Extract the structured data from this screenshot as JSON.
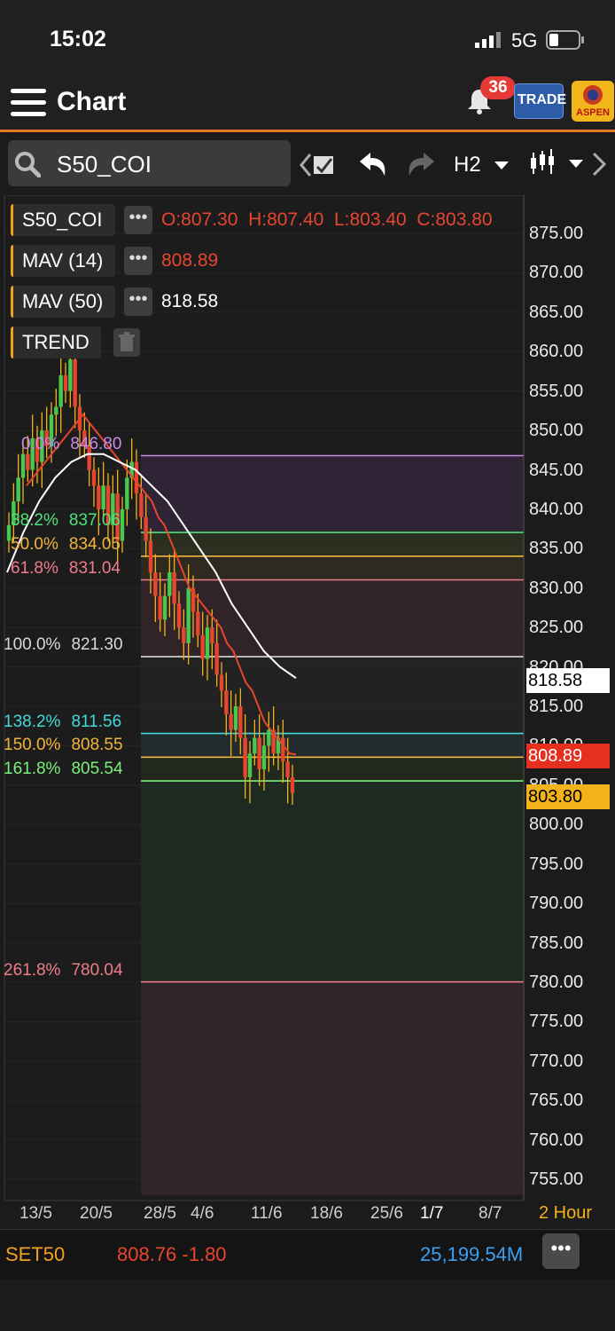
{
  "status": {
    "time": "15:02",
    "network": "5G"
  },
  "header": {
    "title": "Chart",
    "notification_count": "36",
    "trade_label": "TRADE",
    "aspen_label": "ASPEN"
  },
  "toolbar": {
    "symbol": "S50_COI",
    "timeframe": "H2"
  },
  "legend": {
    "symbol": "S50_COI",
    "ohlc": "O:807.30  H:807.40  L:803.40  C:803.80",
    "mav14_label": "MAV (14)",
    "mav14_value": "808.89",
    "mav50_label": "MAV (50)",
    "mav50_value": "818.58",
    "trend_label": "TREND",
    "dots": "•••"
  },
  "price_axis": [
    "875.00",
    "870.00",
    "865.00",
    "860.00",
    "855.00",
    "850.00",
    "845.00",
    "840.00",
    "835.00",
    "830.00",
    "825.00",
    "820.00",
    "815.00",
    "810.00",
    "805.00",
    "800.00",
    "795.00",
    "790.00",
    "785.00",
    "780.00",
    "775.00",
    "770.00",
    "765.00",
    "760.00",
    "755.00"
  ],
  "price_tags": {
    "mav50": "818.58",
    "mav14": "808.89",
    "last": "803.80"
  },
  "fib_levels": [
    {
      "pct": "0.0%",
      "value": "846.80",
      "color": "#c98be8"
    },
    {
      "pct": "38.2%",
      "value": "837.06",
      "color": "#52e07b"
    },
    {
      "pct": "50.0%",
      "value": "834.05",
      "color": "#f2b53a"
    },
    {
      "pct": "61.8%",
      "value": "831.04",
      "color": "#f07c8c"
    },
    {
      "pct": "100.0%",
      "value": "821.30",
      "color": "#d9d9d9"
    },
    {
      "pct": "138.2%",
      "value": "811.56",
      "color": "#43d9d9"
    },
    {
      "pct": "150.0%",
      "value": "808.55",
      "color": "#f2b53a"
    },
    {
      "pct": "161.8%",
      "value": "805.54",
      "color": "#7cf07c"
    },
    {
      "pct": "261.8%",
      "value": "780.04",
      "color": "#f07c8c"
    }
  ],
  "date_axis": [
    "13/5",
    "20/5",
    "28/5",
    "4/6",
    "11/6",
    "18/6",
    "25/6",
    "1/7",
    "8/7"
  ],
  "period_label": "2 Hour",
  "footer": {
    "index": "SET50",
    "quote": "808.76 -1.80",
    "value": "25,199.54M"
  },
  "colors": {
    "up": "#45c94f",
    "down": "#e8452f",
    "mav14": "#e8452f",
    "mav50": "#ffffff",
    "accent": "#f0a21b"
  },
  "chart_data": {
    "type": "candlestick",
    "symbol": "S50_COI",
    "timeframe": "H2",
    "ylim": [
      753,
      878
    ],
    "x_ticks": [
      "13/5",
      "20/5",
      "28/5",
      "4/6",
      "11/6",
      "18/6",
      "25/6",
      "1/7",
      "8/7"
    ],
    "close_series": [
      838,
      841,
      844,
      847,
      845,
      849,
      846,
      850,
      848,
      852,
      853,
      857,
      855,
      859,
      853,
      850,
      848,
      845,
      843,
      840,
      843,
      838,
      842,
      836,
      840,
      844,
      846,
      842,
      839,
      836,
      832,
      829,
      826,
      829,
      832,
      828,
      825,
      823,
      830,
      827,
      824,
      821,
      825,
      823,
      819,
      817,
      814,
      812,
      815,
      811,
      806,
      809,
      811,
      807,
      810,
      812,
      809,
      811,
      808,
      806,
      804
    ],
    "mav14": [
      843,
      844,
      845,
      846,
      847,
      848,
      849,
      850,
      851,
      852,
      851,
      850,
      849,
      848,
      847,
      846,
      845,
      844,
      843,
      842,
      841,
      839,
      838,
      836,
      834,
      832,
      830,
      829,
      828,
      827,
      826,
      825,
      823,
      822,
      820,
      818,
      817,
      815,
      813,
      812,
      811,
      810,
      809,
      808.89
    ],
    "mav50": [
      832,
      837,
      841,
      844,
      846,
      847,
      847,
      846,
      845,
      843,
      841,
      838,
      835,
      832,
      828,
      825,
      822,
      820,
      818.58
    ],
    "last": {
      "open": 807.3,
      "high": 807.4,
      "low": 803.4,
      "close": 803.8
    },
    "indicators": {
      "mav14": 808.89,
      "mav50": 818.58
    },
    "fibonacci": {
      "high": 846.8,
      "low": 821.3
    }
  }
}
